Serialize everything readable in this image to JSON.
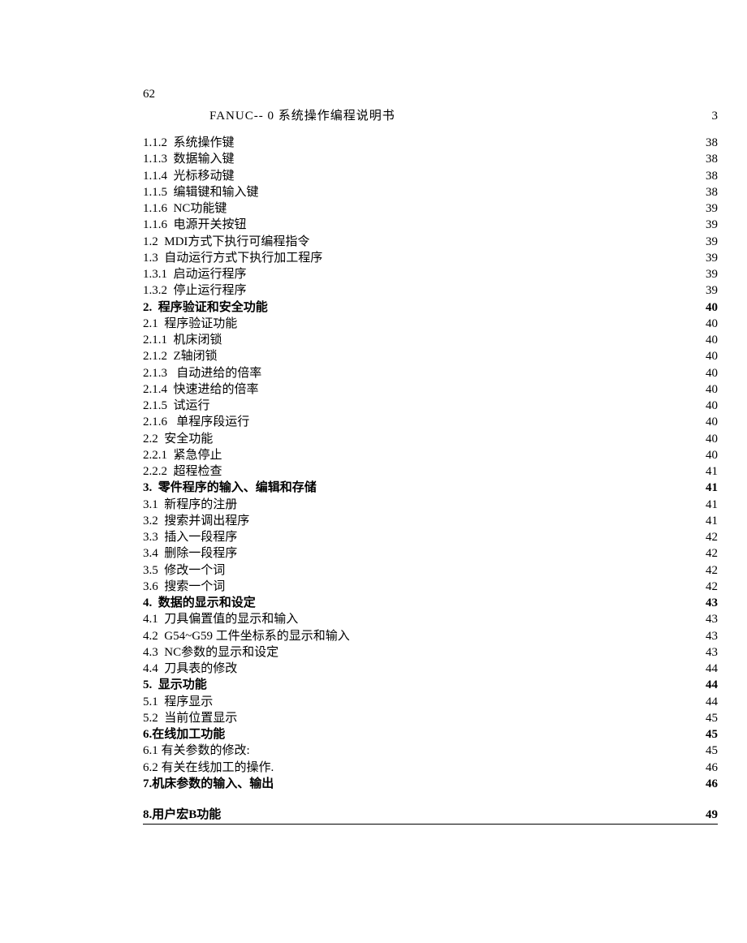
{
  "pageNumTop": "62",
  "docTitle": "FANUC-- 0 系统操作编程说明书",
  "docTitleNum": "3",
  "toc": [
    {
      "label": "1.1.2  系统操作键",
      "page": "38",
      "bold": false
    },
    {
      "label": "1.1.3  数据输入键",
      "page": "38",
      "bold": false
    },
    {
      "label": "1.1.4  光标移动键",
      "page": "38",
      "bold": false
    },
    {
      "label": "1.1.5  编辑键和输入键",
      "page": "38",
      "bold": false
    },
    {
      "label": "1.1.6  NC功能键",
      "page": "39",
      "bold": false
    },
    {
      "label": "1.1.6  电源开关按钮",
      "page": "39",
      "bold": false
    },
    {
      "label": "1.2  MDI方式下执行可编程指令",
      "page": "39",
      "bold": false
    },
    {
      "label": "1.3  自动运行方式下执行加工程序",
      "page": "39",
      "bold": false
    },
    {
      "label": "1.3.1  启动运行程序",
      "page": "39",
      "bold": false
    },
    {
      "label": "1.3.2  停止运行程序",
      "page": "39",
      "bold": false
    },
    {
      "label": "2.  程序验证和安全功能",
      "page": "40",
      "bold": true
    },
    {
      "label": "2.1  程序验证功能",
      "page": "40",
      "bold": false
    },
    {
      "label": "2.1.1  机床闭锁",
      "page": "40",
      "bold": false
    },
    {
      "label": "2.1.2  Z轴闭锁",
      "page": "40",
      "bold": false
    },
    {
      "label": "2.1.3   自动进给的倍率",
      "page": "40",
      "bold": false
    },
    {
      "label": "2.1.4  快速进给的倍率",
      "page": "40",
      "bold": false
    },
    {
      "label": "2.1.5  试运行",
      "page": "40",
      "bold": false
    },
    {
      "label": "2.1.6   单程序段运行",
      "page": "40",
      "bold": false
    },
    {
      "label": "2.2  安全功能",
      "page": "40",
      "bold": false
    },
    {
      "label": "2.2.1  紧急停止",
      "page": "40",
      "bold": false
    },
    {
      "label": "2.2.2  超程检查",
      "page": "41",
      "bold": false
    },
    {
      "label": "3.  零件程序的输入、编辑和存储",
      "page": "41",
      "bold": true
    },
    {
      "label": "3.1  新程序的注册",
      "page": "41",
      "bold": false
    },
    {
      "label": "3.2  搜索并调出程序",
      "page": "41",
      "bold": false
    },
    {
      "label": "3.3  插入一段程序",
      "page": "42",
      "bold": false
    },
    {
      "label": "3.4  删除一段程序",
      "page": "42",
      "bold": false
    },
    {
      "label": "3.5  修改一个词",
      "page": "42",
      "bold": false
    },
    {
      "label": "3.6  搜索一个词",
      "page": "42",
      "bold": false
    },
    {
      "label": "4.  数据的显示和设定",
      "page": "43",
      "bold": true
    },
    {
      "label": "4.1  刀具偏置值的显示和输入",
      "page": "43",
      "bold": false
    },
    {
      "label": "4.2  G54~G59 工件坐标系的显示和输入",
      "page": "43",
      "bold": false
    },
    {
      "label": "4.3  NC参数的显示和设定",
      "page": "43",
      "bold": false
    },
    {
      "label": "4.4  刀具表的修改",
      "page": "44",
      "bold": false
    },
    {
      "label": "5.  显示功能",
      "page": "44",
      "bold": true
    },
    {
      "label": "5.1  程序显示",
      "page": "44",
      "bold": false
    },
    {
      "label": "5.2  当前位置显示",
      "page": "45",
      "bold": false
    },
    {
      "label": "6.在线加工功能",
      "page": "45",
      "bold": true
    },
    {
      "label": "6.1 有关参数的修改:",
      "page": "45",
      "bold": false
    },
    {
      "label": "6.2 有关在线加工的操作.",
      "page": "46",
      "bold": false
    },
    {
      "label": "7.机床参数的输入、输出",
      "page": "46",
      "bold": true
    }
  ],
  "lastRow": {
    "label": "8.用户宏B功能",
    "page": "49",
    "bold": true
  }
}
